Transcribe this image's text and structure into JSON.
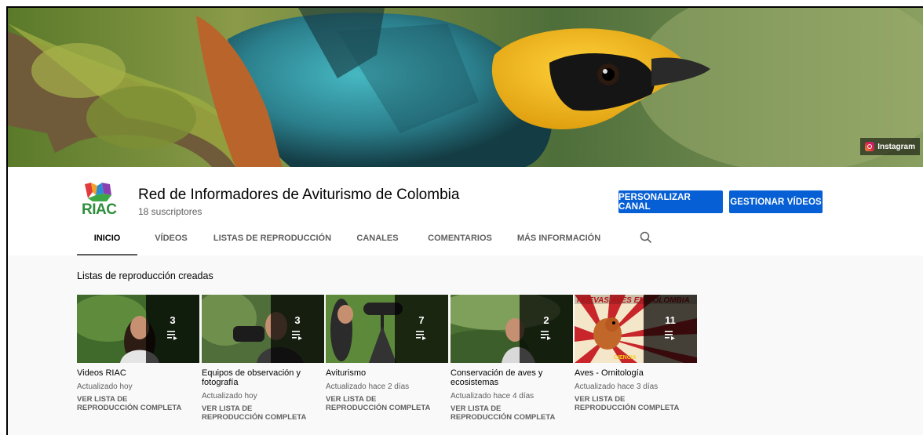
{
  "banner": {
    "social_link": "Instagram"
  },
  "channel": {
    "logo_text": "RIAC",
    "title": "Red de Informadores de Aviturismo de Colombia",
    "subscribers": "18 suscriptores",
    "customize_button": "PERSONALIZAR CANAL",
    "manage_button": "GESTIONAR VÍDEOS"
  },
  "tabs": [
    {
      "label": "INICIO",
      "active": true
    },
    {
      "label": "VÍDEOS"
    },
    {
      "label": "LISTAS DE REPRODUCCIÓN"
    },
    {
      "label": "CANALES"
    },
    {
      "label": "COMENTARIOS"
    },
    {
      "label": "MÁS INFORMACIÓN"
    }
  ],
  "section": {
    "title": "Listas de reproducción creadas"
  },
  "playlists": [
    {
      "title": "Videos RIAC",
      "count": "3",
      "updated": "Actualizado hoy",
      "action": "VER LISTA DE REPRODUCCIÓN COMPLETA"
    },
    {
      "title": "Equipos de observación y fotografía",
      "count": "3",
      "updated": "Actualizado hoy",
      "action": "VER LISTA DE REPRODUCCIÓN COMPLETA"
    },
    {
      "title": "Aviturismo",
      "count": "7",
      "updated": "Actualizado hace 2 días",
      "action": "VER LISTA DE REPRODUCCIÓN COMPLETA"
    },
    {
      "title": "Conservación de aves y ecosistemas",
      "count": "2",
      "updated": "Actualizado hace 4 días",
      "action": "VER LISTA DE REPRODUCCIÓN COMPLETA"
    },
    {
      "title": "Aves - Ornitología",
      "count": "11",
      "updated": "Actualizado hace 3 días",
      "action": "VER LISTA DE REPRODUCCIÓN COMPLETA",
      "thumb_text": "NUEVAS AVES EN COLOMBIA",
      "thumb_caption": "CIENCIA"
    }
  ],
  "colors": {
    "accent_blue": "#065fd4",
    "text_secondary": "#606060",
    "logo_green": "#2f8e3d"
  },
  "icons": [
    "instagram-icon",
    "search-icon",
    "playlist-icon"
  ]
}
